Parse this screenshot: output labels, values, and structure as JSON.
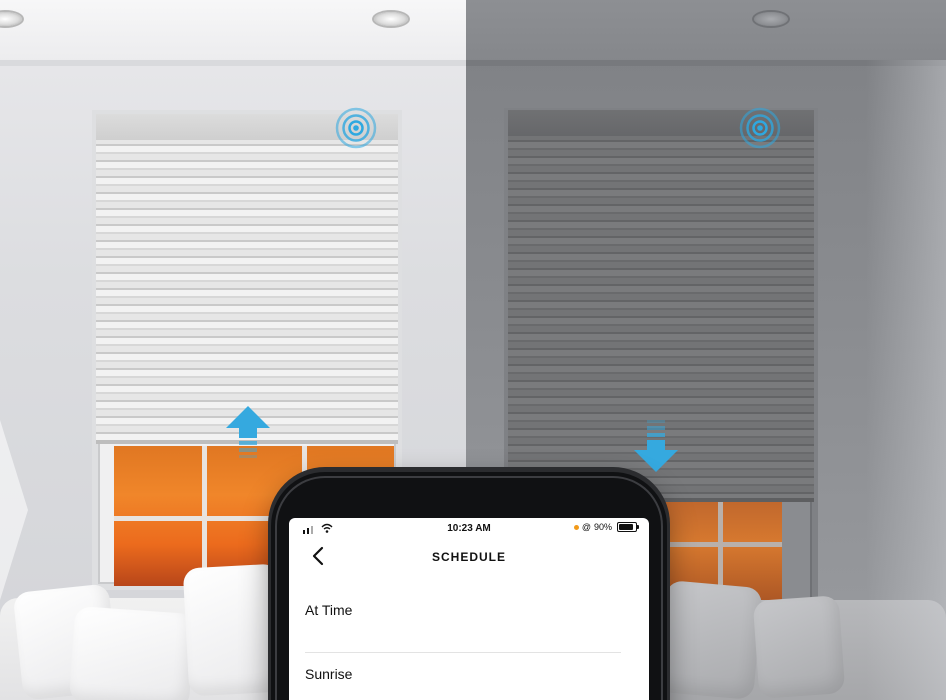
{
  "scene": {
    "left_state": "blind-raised",
    "right_state": "blind-lowered",
    "colors": {
      "signal_blue": "#2ea8e0",
      "arrow_blue": "#35a9df",
      "sunset_orange": "#ec6b1d"
    },
    "icons": [
      "signal-icon",
      "arrow-up-icon",
      "arrow-down-icon"
    ]
  },
  "phone": {
    "status_bar": {
      "time": "10:23 AM",
      "battery_text": "90%",
      "battery_level": 0.9,
      "location_symbol": "@",
      "signal_bars": 2,
      "icons": [
        "signal-bars-icon",
        "wifi-icon",
        "location-icon",
        "battery-icon"
      ]
    },
    "header": {
      "title": "SCHEDULE",
      "back_icon": "chevron-left-icon"
    },
    "list": {
      "items": [
        {
          "label": "At Time"
        },
        {
          "label": "Sunrise"
        }
      ]
    }
  }
}
